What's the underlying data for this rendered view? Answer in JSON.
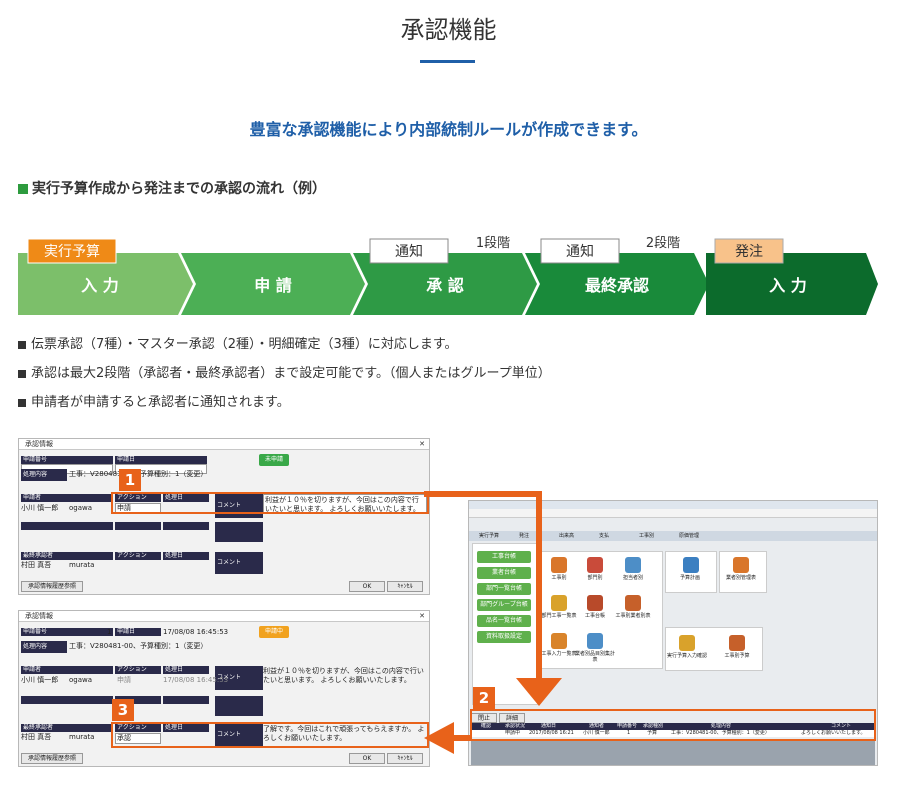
{
  "header": {
    "title": "承認機能",
    "lead": "豊富な承認機能により内部統制ルールが作成できます。",
    "section": "実行予算作成から発注までの承認の流れ（例）"
  },
  "flow": {
    "steps": [
      {
        "label": "入 力",
        "tag": "実行予算",
        "color": "#7cbf6a"
      },
      {
        "label": "申 請",
        "tag": "",
        "color": "#4caf55"
      },
      {
        "label": "承 認",
        "tag": "通知",
        "stage": "1段階",
        "color": "#2e9a45"
      },
      {
        "label": "最終承認",
        "tag": "通知",
        "stage": "2段階",
        "color": "#198a3a"
      },
      {
        "label": "入 力",
        "tag": "発注",
        "color": "#0c6b2c"
      }
    ]
  },
  "bullets": [
    "伝票承認（7種）・マスター承認（2種）・明細確定（3種）に対応します。",
    "承認は最大2段階（承認者・最終承認者）まで設定可能です。（個人またはグループ単位）",
    "申請者が申請すると承認者に通知されます。"
  ],
  "dialog1": {
    "title": "承認情報",
    "req_no_label": "申請番号",
    "req_date_label": "申請日",
    "status_badge": "未申請",
    "target_label": "処理内容",
    "target_value": "工事：V280481-00、予算種別：1（変更）",
    "applicant_label": "申請者",
    "action_label": "アクション",
    "date_label": "処理日",
    "comment_label": "コメント",
    "applicant_name": "小川 慎一郎",
    "applicant_id": "ogawa",
    "action_value": "申請",
    "comment": "利益が１０％を切りますが、今回はこの内容で行いたいと思います。 よろしくお願いいたします。",
    "final_label": "最終承認者",
    "final_name": "村田 真吾",
    "final_id": "murata",
    "history_btn": "承認情報履歴参照",
    "ok": "OK",
    "cancel": "ｷｬﾝｾﾙ"
  },
  "dialog2": {
    "title": "承認情報",
    "req_no_label": "申請番号",
    "req_no": "1",
    "req_date_label": "申請日",
    "req_date": "17/08/08 16:45:53",
    "status_badge": "申請中",
    "target_label": "処理内容",
    "target_value": "工事：V280481-00、予算種別：1（変更）",
    "applicant_label": "申請者",
    "action_label": "アクション",
    "date_label": "処理日",
    "comment_label": "コメント",
    "applicant_name": "小川 慎一郎",
    "applicant_id": "ogawa",
    "action_value": "申請",
    "action_date": "17/08/08 16:45:53",
    "comment": "利益が１０％を切りますが、今回はこの内容で行いたいと思います。 よろしくお願いいたします。",
    "final_label": "最終承認者",
    "final_name": "村田 真吾",
    "final_id": "murata",
    "final_action": "承認",
    "final_comment": "了解です。今回はこれで頑張ってもらえますか。 よろしくお願いいたします。",
    "history_btn": "承認情報履歴参照",
    "ok": "OK",
    "cancel": "ｷｬﾝｾﾙ"
  },
  "menu": {
    "tabs": [
      "実行予算",
      "発注",
      "出来高",
      "支払",
      "工事別",
      "原価管理"
    ],
    "left_buttons": [
      "工事台帳",
      "業者台帳",
      "部門一覧台帳",
      "部門グループ台帳",
      "品名一覧台帳",
      "資料取扱設定"
    ],
    "icon_labels": [
      "工事別",
      "部門別",
      "担当者別",
      "部門工事一覧表",
      "工事台帳",
      "工事別業者別表",
      "工事入力一覧表",
      "業者別品目別集計表",
      "予算計画",
      "業者別管理表",
      "実行予算入力確認",
      "工事別予算"
    ],
    "list_btns": [
      "閉止",
      "詳細"
    ],
    "list_header": [
      "確認",
      "承認状況",
      "通知日",
      "通知者",
      "申請番号",
      "承認種別",
      "処理内容",
      "コメント"
    ],
    "list_row": [
      "",
      "申請中",
      "2017/08/08 16:21",
      "小川 慎一郎",
      "1",
      "予算",
      "工事：V280481-00、予算種別：1（変更）",
      "よろしくお願いいたします。"
    ]
  },
  "callouts": [
    "1",
    "2",
    "3"
  ],
  "colors": {
    "accent": "#1f5fa8",
    "orange": "#e8621a",
    "green": "#2d9b3e"
  }
}
